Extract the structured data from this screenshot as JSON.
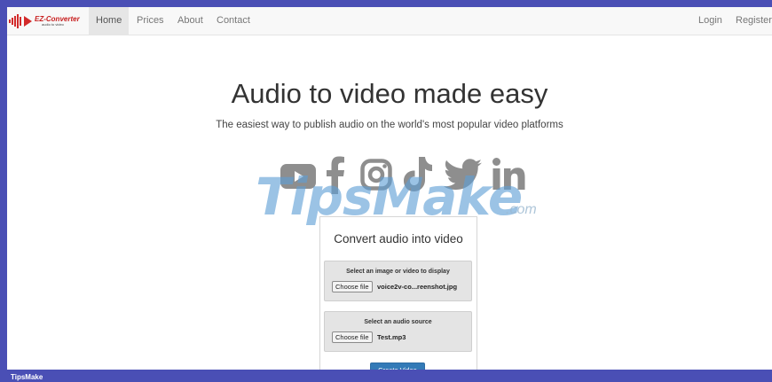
{
  "brand": {
    "name": "EZ-Converter",
    "tagline": "audio to video",
    "color": "#c81f1f"
  },
  "nav": {
    "links": [
      {
        "label": "Home",
        "active": true
      },
      {
        "label": "Prices",
        "active": false
      },
      {
        "label": "About",
        "active": false
      },
      {
        "label": "Contact",
        "active": false
      }
    ],
    "right": [
      {
        "label": "Login"
      },
      {
        "label": "Register"
      }
    ]
  },
  "hero": {
    "title": "Audio to video made easy",
    "subtitle": "The easiest way to publish audio on the world's most popular video platforms"
  },
  "platform_icons": [
    "youtube-icon",
    "facebook-icon",
    "instagram-icon",
    "tiktok-icon",
    "twitter-icon",
    "linkedin-icon"
  ],
  "watermark": {
    "main": "TipsMake",
    "suffix": ".com"
  },
  "converter": {
    "title": "Convert audio into video",
    "image_panel": {
      "label": "Select an image or video to display",
      "button": "Choose file",
      "file": "voice2v-co...reenshot.jpg"
    },
    "audio_panel": {
      "label": "Select an audio source",
      "button": "Choose file",
      "file": "Test.mp3"
    },
    "submit": "Create Video"
  },
  "footer": {
    "label": "TipsMake"
  },
  "colors": {
    "accent": "#337ab7",
    "frame_border": "#4a4fb5"
  }
}
